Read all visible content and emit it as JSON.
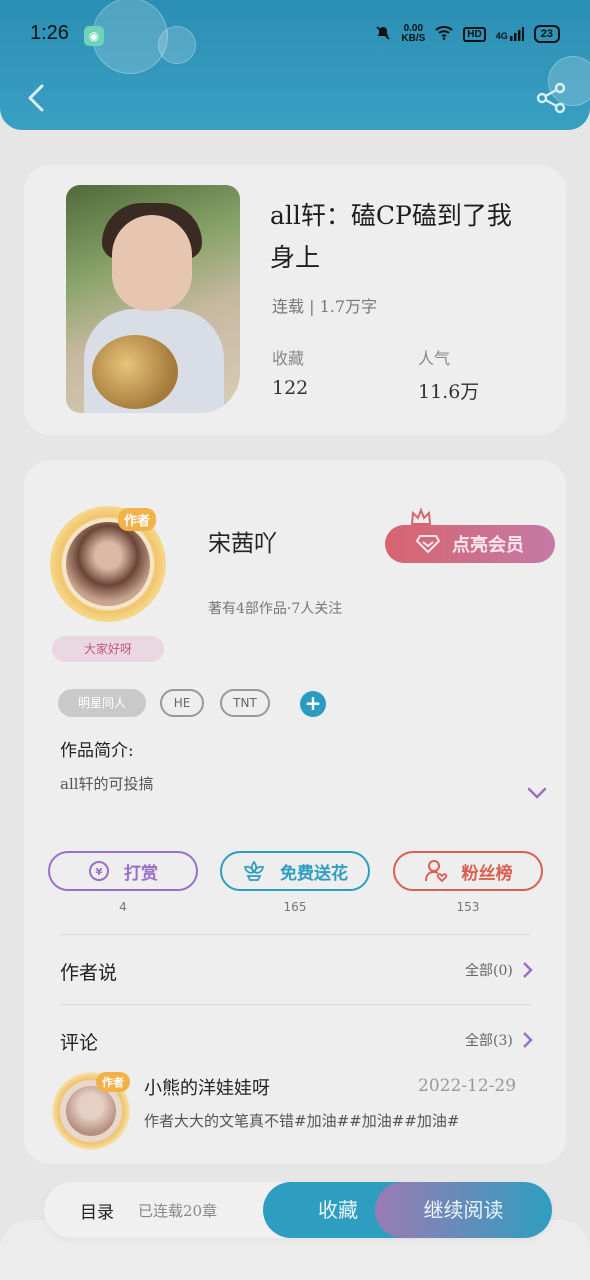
{
  "status_bar": {
    "time": "1:26",
    "net_speed": "0.00",
    "net_unit": "KB/S",
    "hd": "HD",
    "signal": "4G",
    "battery": "23"
  },
  "icons": {
    "back": "chevron-left-icon",
    "share": "share-icon"
  },
  "book": {
    "title": "all轩：磕CP磕到了我身上",
    "meta": "连载 | 1.7万字",
    "stats": [
      {
        "label": "收藏",
        "value": "122"
      },
      {
        "label": "人气",
        "value": "11.6万"
      }
    ]
  },
  "author": {
    "badge": "作者",
    "caption": "大家好呀",
    "name": "宋茜吖",
    "summary": "著有4部作品·7人关注",
    "vip_label": "点亮会员",
    "tags": [
      "明星同人",
      "HE",
      "TNT"
    ],
    "add_tag": "+",
    "intro_label": "作品简介:",
    "intro_text": "all轩的可投搞"
  },
  "actions": [
    {
      "label": "打赏",
      "count": "4",
      "color": "#9a6fc8"
    },
    {
      "label": "免费送花",
      "count": "165",
      "color": "#2e9ec0"
    },
    {
      "label": "粉丝榜",
      "count": "153",
      "color": "#d9604e"
    }
  ],
  "sections": {
    "author_says": {
      "label": "作者说",
      "link": "全部(0)"
    },
    "comments": {
      "label": "评论",
      "link": "全部(3)"
    }
  },
  "comment": {
    "badge": "作者",
    "user": "小熊的洋娃娃呀",
    "date": "2022-12-29",
    "text": "作者大大的文笔真不错#加油##加油##加油#"
  },
  "bottom_bar": {
    "toc_label": "目录",
    "toc_sub": "已连载20章",
    "collect": "收藏",
    "continue": "继续阅读"
  }
}
